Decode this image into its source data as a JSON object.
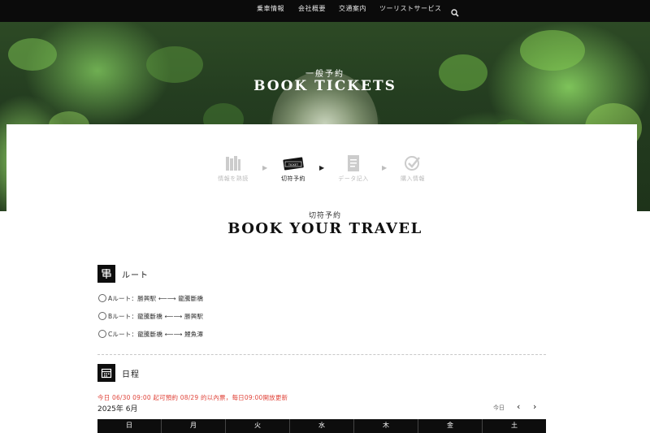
{
  "nav": {
    "items": [
      "乗車情報",
      "会社概要",
      "交通案内",
      "ツーリストサービス"
    ],
    "search_icon": "search-icon"
  },
  "hero": {
    "subtitle": "一般予約",
    "title": "BOOK TICKETS"
  },
  "steps": [
    {
      "label": "情報を熟読",
      "icon": "books-icon",
      "state": "inactive"
    },
    {
      "label": "切符予約",
      "icon": "ticket-icon",
      "state": "active"
    },
    {
      "label": "データ記入",
      "icon": "document-icon",
      "state": "inactive"
    },
    {
      "label": "購入情報",
      "icon": "checkmark-icon",
      "state": "inactive"
    }
  ],
  "section": {
    "subtitle": "切符予約",
    "title": "BOOK YOUR TRAVEL"
  },
  "route": {
    "heading": "ルート",
    "options": [
      "Aルート：勝興駅 ⟵⟶ 龍騰斷橋",
      "Bルート：龍騰斷橋 ⟵⟶ 勝興駅",
      "Cルート：龍騰斷橋 ⟵⟶ 鯉魚潭"
    ]
  },
  "schedule": {
    "heading": "日程",
    "notice": "今日 06/30 09:00 起可預約 08/29 的以內票，每日09:00開放更新",
    "month": "2025年 6月",
    "today_label": "今日",
    "prev": "‹",
    "next": "›",
    "weekdays": [
      "日",
      "月",
      "火",
      "水",
      "木",
      "金",
      "土"
    ]
  },
  "colors": {
    "nav_bg": "#0b0b0b",
    "accent_dark": "#0d0d0d",
    "notice": "#e0443a",
    "inactive": "#bbbbbb"
  }
}
